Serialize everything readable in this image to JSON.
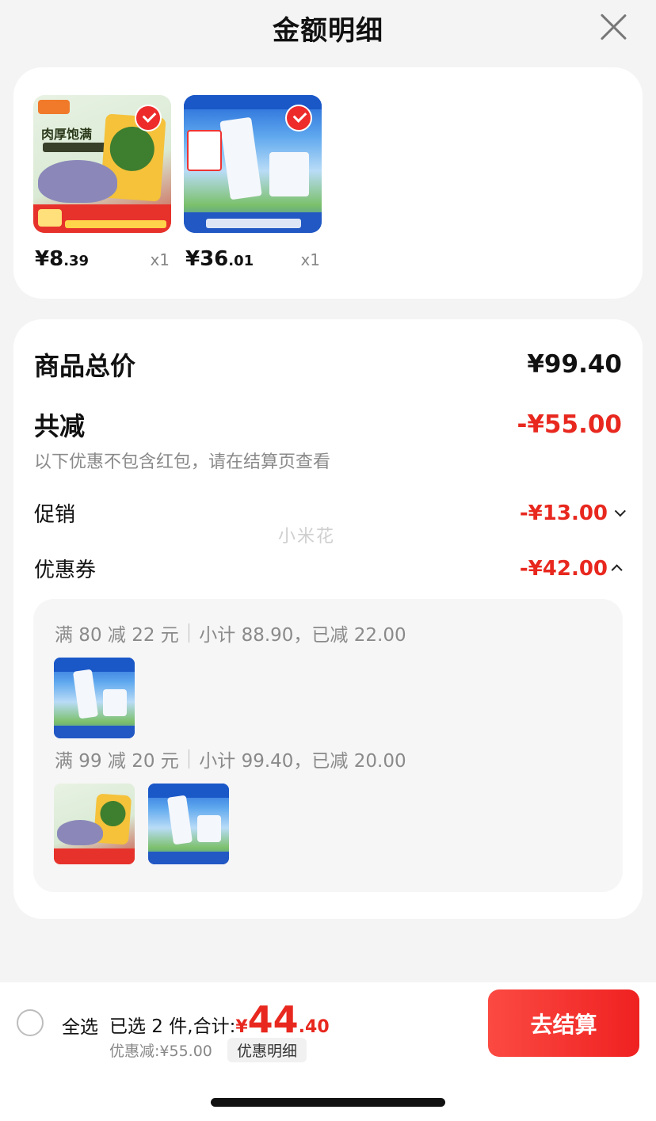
{
  "header": {
    "title": "金额明细"
  },
  "products": [
    {
      "name": "snack",
      "price_int": "¥8",
      "price_dec": ".39",
      "qty": "x1"
    },
    {
      "name": "milk",
      "price_int": "¥36",
      "price_dec": ".01",
      "qty": "x1"
    }
  ],
  "summary": {
    "total_label": "商品总价",
    "total_value": "¥99.40",
    "reduce_label": "共减",
    "reduce_value": "-¥55.00",
    "note": "以下优惠不包含红包，请在结算页查看",
    "promo_label": "促销",
    "promo_value": "-¥13.00",
    "coupon_label": "优惠券",
    "coupon_value": "-¥42.00",
    "watermark": "小米花",
    "coupons": [
      {
        "rule": "满 80 减 22 元",
        "detail": "小计 88.90，已减 22.00"
      },
      {
        "rule": "满 99 减 20 元",
        "detail": "小计 99.40，已减 20.00"
      }
    ]
  },
  "bottom": {
    "select_all": "全选",
    "selected_prefix": "已选 2 件,合计:",
    "amount_symbol": "¥",
    "amount_int": "44",
    "amount_dec": ".40",
    "discount_text": "优惠减:¥55.00",
    "detail_button": "优惠明细",
    "checkout_button": "去结算"
  },
  "colors": {
    "accent_red": "#e8281f",
    "checkout_gradient": [
      "#fb4a42",
      "#ef2121"
    ]
  },
  "icons": [
    "close-icon",
    "check-icon",
    "chevron-down-icon",
    "chevron-up-icon",
    "radio-icon"
  ]
}
